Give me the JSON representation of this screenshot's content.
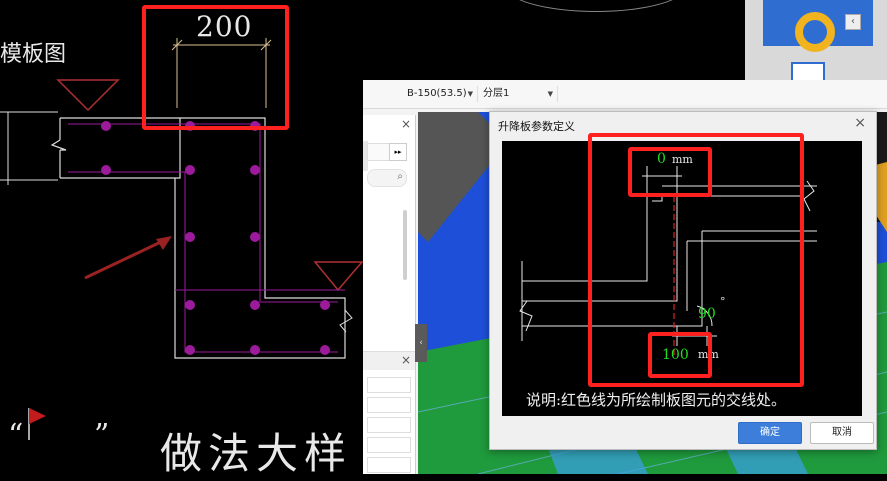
{
  "cad": {
    "dimension_top": "200",
    "side_label": "模板图",
    "bottom_quote_left": "“",
    "bottom_quote_right": "”",
    "bottom_heading": "做法大样"
  },
  "toolbar": {
    "type_select": "B-150(53.5)",
    "layer_select": "分层1"
  },
  "panel": {
    "close_glyph": "×",
    "expand_glyph": "▸▸",
    "collapse_glyph": "‹"
  },
  "dialog": {
    "title": "升降板参数定义",
    "close_glyph": "×",
    "top_offset_value": "0",
    "top_offset_unit": "mm",
    "angle_value": "90",
    "angle_unit": "°",
    "bottom_value": "100",
    "bottom_unit": "mm",
    "note": "说明:红色线为所绘制板图元的交线处。",
    "ok_label": "确定",
    "cancel_label": "取消"
  },
  "colors": {
    "highlight_red": "#ff2020",
    "rebar_purple": "#9b1b9b",
    "dim_green": "#22dd22",
    "accent_blue": "#3d7edb",
    "viewport_blue": "#1e4fd8",
    "viewport_green": "#1f9a3c"
  }
}
